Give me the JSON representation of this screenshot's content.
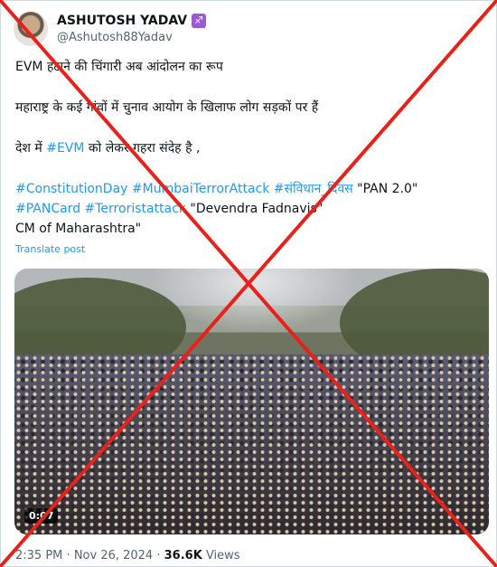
{
  "author": {
    "name": "ASHUTOSH YADAV",
    "badge": "♐",
    "handle": "@Ashutosh88Yadav"
  },
  "post": {
    "lines": [
      [
        {
          "text": "EVM हटाने की चिंगारी अब आंदोलन का रूप"
        }
      ],
      [
        {
          "text": "महाराष्ट्र के कई गांवों में चुनाव आयोग के  खिलाफ लोग सड़कों पर  हैं"
        }
      ],
      [
        {
          "text": "देश में "
        },
        {
          "text": "#EVM",
          "tag": true
        },
        {
          "text": " को लेकर गहरा संदेह है ,"
        }
      ],
      [
        {
          "text": "#ConstitutionDay",
          "tag": true
        },
        {
          "text": " "
        },
        {
          "text": "#MumbaiTerrorAttack",
          "tag": true
        },
        {
          "text": " "
        },
        {
          "text": "#संविधान_दिवस",
          "tag": true
        },
        {
          "text": " \"PAN 2.0\""
        }
      ],
      [
        {
          "text": "#PANCard",
          "tag": true
        },
        {
          "text": " "
        },
        {
          "text": "#Terroristattack",
          "tag": true
        },
        {
          "text": " \"Devendra Fadnavis\""
        }
      ],
      [
        {
          "text": "CM of Maharashtra\""
        }
      ]
    ],
    "translate_label": "Translate post"
  },
  "media": {
    "timestamp": "0:07"
  },
  "meta": {
    "time": "2:35 PM",
    "separator": "·",
    "date": "Nov 26, 2024",
    "views_count": "36.6K",
    "views_label": "Views"
  },
  "overlay": {
    "cross_color": "#e8221b"
  }
}
